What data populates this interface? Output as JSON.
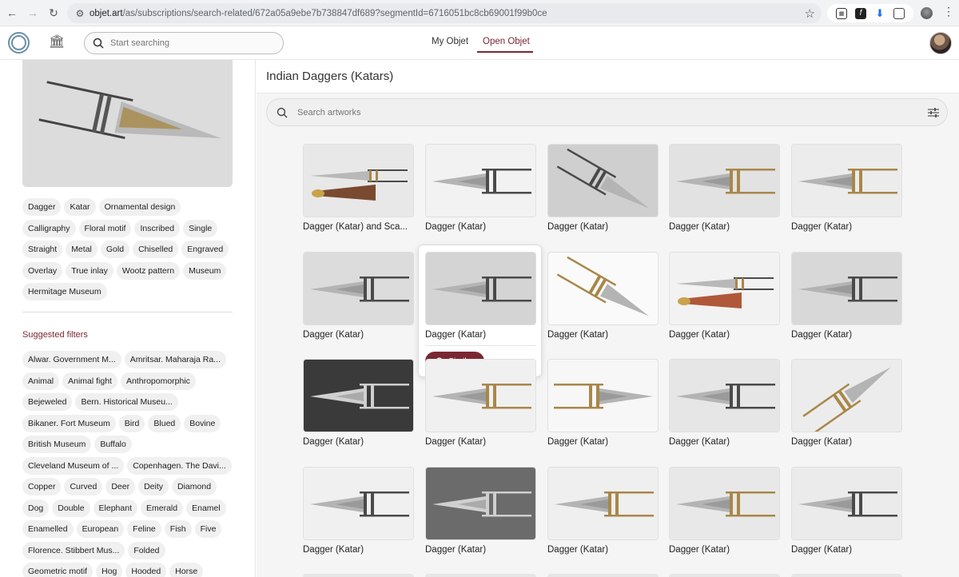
{
  "browser": {
    "url_host": "objet.art",
    "url_path": "/as/subscriptions/search-related/672a05a9ebe7b738847df689?segmentId=6716051bc8cb69001f99b0ce"
  },
  "header": {
    "search_placeholder": "Start searching",
    "tabs": [
      "My Objet",
      "Open Objet"
    ],
    "active_tab": "Open Objet"
  },
  "sidebar": {
    "tags": [
      "Dagger",
      "Katar",
      "Ornamental design",
      "Calligraphy",
      "Floral motif",
      "Inscribed",
      "Single",
      "Straight",
      "Metal",
      "Gold",
      "Chiselled",
      "Engraved",
      "Overlay",
      "True inlay",
      "Wootz pattern",
      "Museum",
      "Hermitage Museum"
    ],
    "suggested_title": "Suggested filters",
    "filters": [
      "Alwar. Government M...",
      "Amritsar. Maharaja Ra...",
      "Animal",
      "Animal fight",
      "Anthropomorphic",
      "Bejeweled",
      "Bern. Historical Museu...",
      "Bikaner. Fort Museum",
      "Bird",
      "Blued",
      "Bovine",
      "British Museum",
      "Buffalo",
      "Cleveland Museum of ...",
      "Copenhagen. The Davi...",
      "Copper",
      "Curved",
      "Deer",
      "Deity",
      "Diamond",
      "Dog",
      "Double",
      "Elephant",
      "Emerald",
      "Enamel",
      "Enamelled",
      "European",
      "Feline",
      "Fish",
      "Five",
      "Florence. Stibbert Mus...",
      "Folded",
      "Geometric motif",
      "Hog",
      "Hooded",
      "Horse"
    ]
  },
  "main": {
    "title": "Indian Daggers (Katars)",
    "search_placeholder": "Search artworks",
    "similar_label": "Similar",
    "items": [
      {
        "caption": "Dagger (Katar) and Sca...",
        "bg": "#e8e8e8",
        "style": "sheath"
      },
      {
        "caption": "Dagger (Katar)",
        "bg": "#f2f2f2",
        "style": "silver"
      },
      {
        "caption": "Dagger (Katar)",
        "bg": "#cfcfcf",
        "style": "diagonal"
      },
      {
        "caption": "Dagger (Katar)",
        "bg": "#e2e2e2",
        "style": "gold"
      },
      {
        "caption": "Dagger (Katar)",
        "bg": "#ececec",
        "style": "gold"
      },
      {
        "caption": "Dagger (Katar)",
        "bg": "#dcdcdc",
        "style": "dark"
      },
      {
        "caption": "Dagger (Katar)",
        "bg": "#d4d4d4",
        "style": "dark"
      },
      {
        "caption": "Dagger (Katar)",
        "bg": "#fafafa",
        "style": "diag-gold"
      },
      {
        "caption": "Dagger (Katar)",
        "bg": "#f2f2f2",
        "style": "sheath-red"
      },
      {
        "caption": "Dagger (Katar)",
        "bg": "#d8d8d8",
        "style": "silver"
      },
      {
        "caption": "Dagger (Katar)",
        "bg": "#3a3a3a",
        "style": "silver"
      },
      {
        "caption": "Dagger (Katar)",
        "bg": "#f0f0f0",
        "style": "gold"
      },
      {
        "caption": "Dagger (Katar)",
        "bg": "#f7f7f7",
        "style": "gold-rev"
      },
      {
        "caption": "Dagger (Katar)",
        "bg": "#e6e6e6",
        "style": "dark"
      },
      {
        "caption": "Dagger (Katar)",
        "bg": "#ececec",
        "style": "diag-gold2"
      },
      {
        "caption": "Dagger (Katar)",
        "bg": "#f0f0f0",
        "style": "silver"
      },
      {
        "caption": "Dagger (Katar)",
        "bg": "#6b6b6b",
        "style": "silver"
      },
      {
        "caption": "Dagger (Katar)",
        "bg": "#efefef",
        "style": "gold"
      },
      {
        "caption": "Dagger (Katar)",
        "bg": "#e8e8e8",
        "style": "gold"
      },
      {
        "caption": "Dagger (Katar)",
        "bg": "#ebebeb",
        "style": "dark"
      }
    ]
  },
  "colors": {
    "accent": "#7a2733",
    "chip_bg": "#f0f0f0"
  }
}
